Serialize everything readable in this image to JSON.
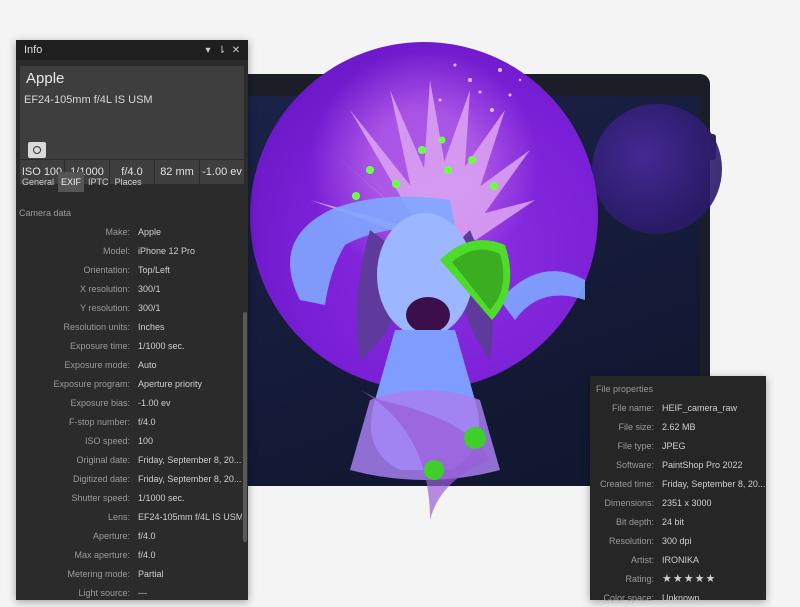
{
  "info_panel": {
    "title": "Info",
    "controls": {
      "dropdown": "▾",
      "pin": "⇂",
      "close": "✕"
    },
    "camera_make": "Apple",
    "lens": "EF24-105mm f/4L IS USM",
    "stats": [
      "ISO 100",
      "1/1000",
      "f/4.0",
      "82 mm",
      "-1.00 ev"
    ],
    "tabs": [
      "General",
      "EXIF",
      "IPTC",
      "Places"
    ],
    "active_tab": "EXIF",
    "section": "Camera data",
    "fields": [
      {
        "label": "Make:",
        "value": "Apple"
      },
      {
        "label": "Model:",
        "value": "iPhone 12 Pro"
      },
      {
        "label": "Orientation:",
        "value": "Top/Left"
      },
      {
        "label": "X resolution:",
        "value": "300/1"
      },
      {
        "label": "Y resolution:",
        "value": "300/1"
      },
      {
        "label": "Resolution units:",
        "value": "Inches"
      },
      {
        "label": "Exposure time:",
        "value": "1/1000 sec."
      },
      {
        "label": "Exposure mode:",
        "value": "Auto"
      },
      {
        "label": "Exposure program:",
        "value": "Aperture priority"
      },
      {
        "label": "Exposure bias:",
        "value": "-1.00 ev"
      },
      {
        "label": "F-stop number:",
        "value": "f/4.0"
      },
      {
        "label": "ISO speed:",
        "value": "100"
      },
      {
        "label": "Original date:",
        "value": "Friday, September 8, 20..."
      },
      {
        "label": "Digitized date:",
        "value": "Friday, September 8, 20..."
      },
      {
        "label": "Shutter speed:",
        "value": "1/1000 sec."
      },
      {
        "label": "Lens:",
        "value": "EF24-105mm f/4L IS USM"
      },
      {
        "label": "Aperture:",
        "value": "f/4.0"
      },
      {
        "label": "Max aperture:",
        "value": "f/4.0"
      },
      {
        "label": "Metering mode:",
        "value": "Partial"
      },
      {
        "label": "Light source:",
        "value": "---"
      }
    ]
  },
  "file_panel": {
    "section": "File properties",
    "fields": [
      {
        "label": "File name:",
        "value": "HEIF_camera_raw"
      },
      {
        "label": "File size:",
        "value": "2.62 MB"
      },
      {
        "label": "File type:",
        "value": "JPEG"
      },
      {
        "label": "Software:",
        "value": "PaintShop Pro 2022"
      },
      {
        "label": "Created time:",
        "value": "Friday, September 8, 20..."
      },
      {
        "label": "Dimensions:",
        "value": "2351 x 3000"
      },
      {
        "label": "Bit depth:",
        "value": "24 bit"
      },
      {
        "label": "Resolution:",
        "value": "300 dpi"
      },
      {
        "label": "Artist:",
        "value": "IRONIKA"
      },
      {
        "label": "Rating:",
        "value": "★★★★★"
      },
      {
        "label": "Color space:",
        "value": "Unknown"
      }
    ]
  },
  "colors": {
    "panel_bg": "#2b2b2b",
    "panel_header": "#1f1f1f",
    "accent_purple": "#7a1fd6",
    "star": "#ffcc2a"
  }
}
